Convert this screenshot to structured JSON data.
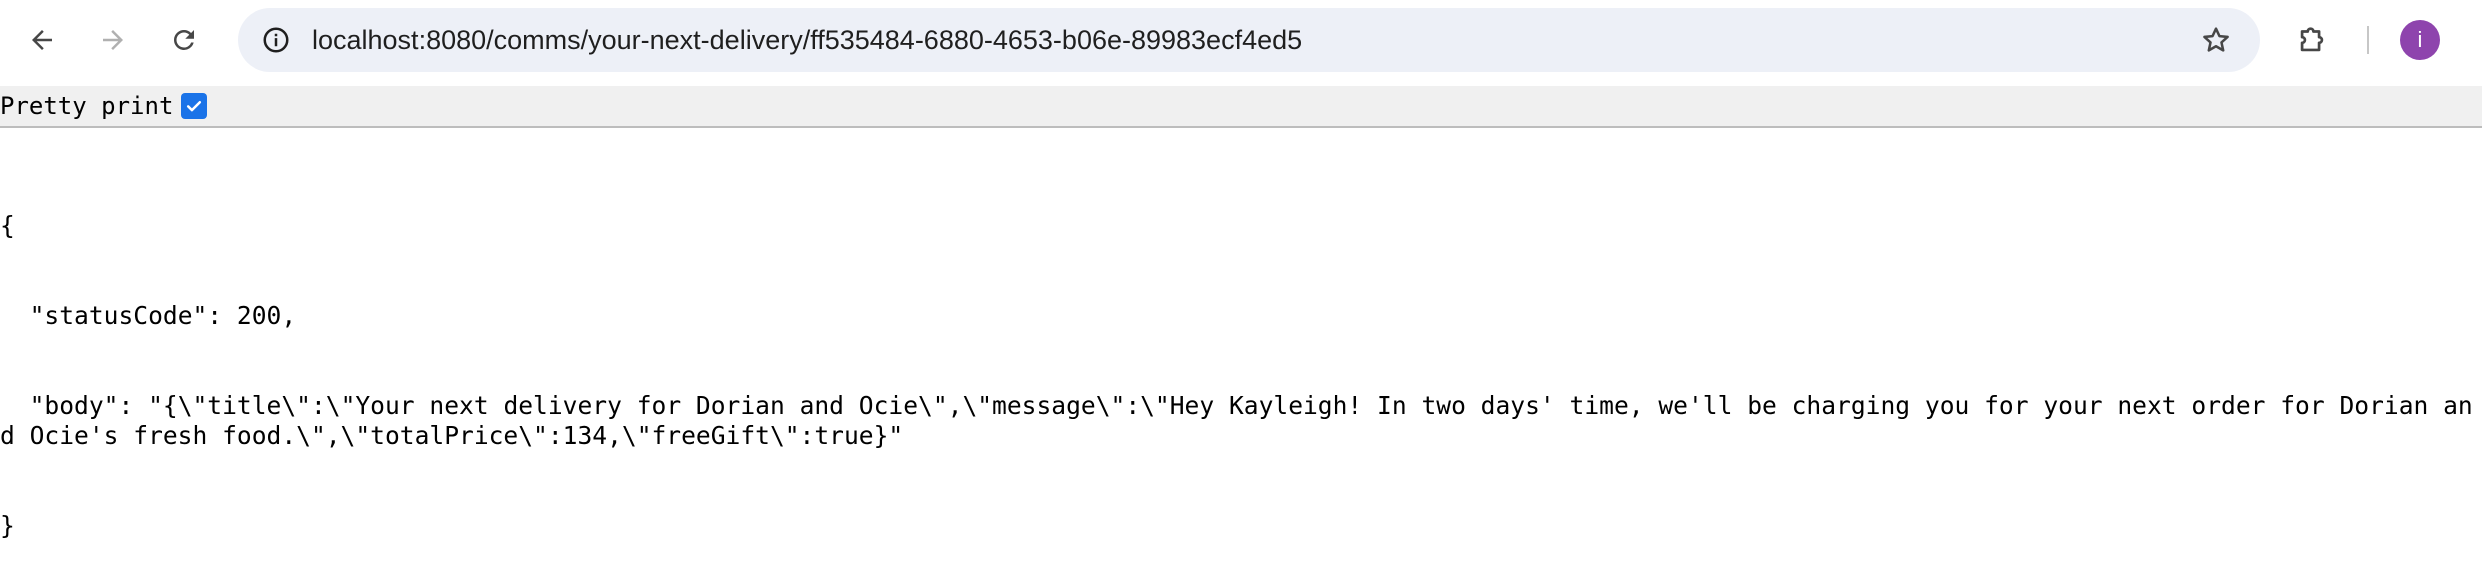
{
  "browser": {
    "url": "localhost:8080/comms/your-next-delivery/ff535484-6880-4653-b06e-89983ecf4ed5",
    "profile_initial": "i"
  },
  "pretty_print": {
    "label": "Pretty print",
    "checked": true
  },
  "json_view": {
    "lines": [
      "{",
      "  \"statusCode\": 200,",
      "  \"body\": \"{\\\"title\\\":\\\"Your next delivery for Dorian and Ocie\\\",\\\"message\\\":\\\"Hey Kayleigh! In two days' time, we'll be charging you for your next order for Dorian and Ocie's fresh food.\\\",\\\"totalPrice\\\":134,\\\"freeGift\\\":true}\"",
      "}"
    ]
  }
}
